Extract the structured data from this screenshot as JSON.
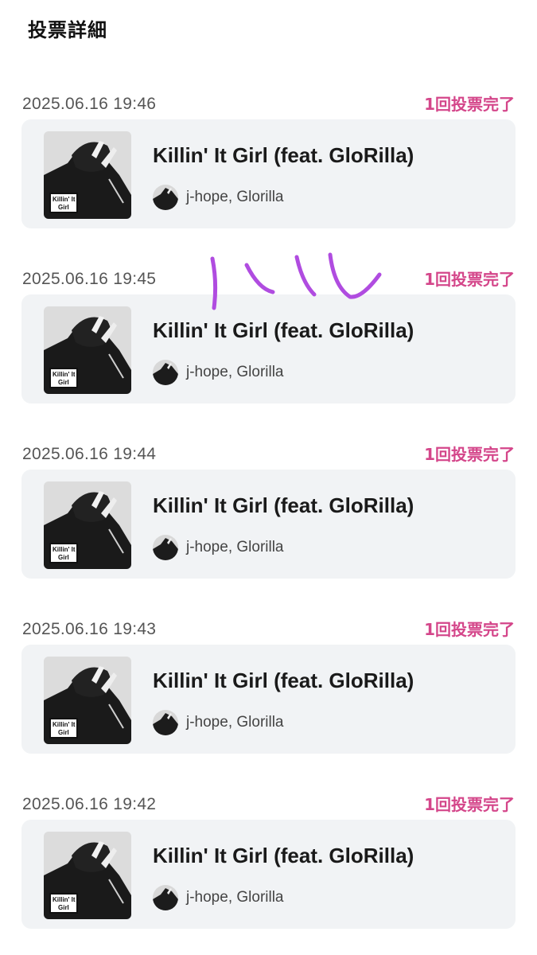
{
  "header": {
    "title": "投票詳細"
  },
  "votes": [
    {
      "time": "2025.06.16 19:46",
      "status": "1回投票完了",
      "song": {
        "title": "Killin' It Girl (feat. GloRilla)",
        "artist": "j-hope, Glorilla",
        "cover_text": [
          "Killin' It",
          "Girl"
        ]
      }
    },
    {
      "time": "2025.06.16 19:45",
      "status": "1回投票完了",
      "song": {
        "title": "Killin' It Girl (feat. GloRilla)",
        "artist": "j-hope, Glorilla",
        "cover_text": [
          "Killin' It",
          "Girl"
        ]
      }
    },
    {
      "time": "2025.06.16 19:44",
      "status": "1回投票完了",
      "song": {
        "title": "Killin' It Girl (feat. GloRilla)",
        "artist": "j-hope, Glorilla",
        "cover_text": [
          "Killin' It",
          "Girl"
        ]
      }
    },
    {
      "time": "2025.06.16 19:43",
      "status": "1回投票完了",
      "song": {
        "title": "Killin' It Girl (feat. GloRilla)",
        "artist": "j-hope, Glorilla",
        "cover_text": [
          "Killin' It",
          "Girl"
        ]
      }
    },
    {
      "time": "2025.06.16 19:42",
      "status": "1回投票完了",
      "song": {
        "title": "Killin' It Girl (feat. GloRilla)",
        "artist": "j-hope, Glorilla",
        "cover_text": [
          "Killin' It",
          "Girl"
        ]
      }
    }
  ],
  "colors": {
    "status": "#d4468a",
    "card_bg": "#f1f3f5",
    "annotation": "#b04ce0"
  },
  "icons": {
    "album": "album-cover-icon",
    "artist": "artist-avatar-icon"
  }
}
